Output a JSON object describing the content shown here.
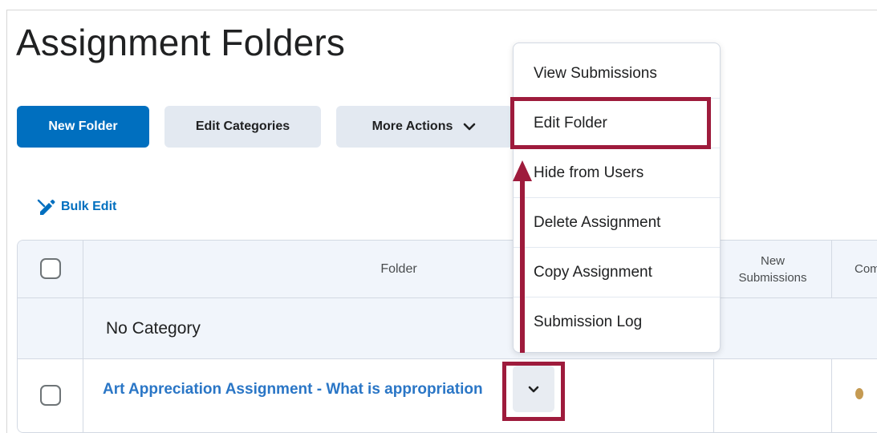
{
  "page": {
    "title": "Assignment Folders"
  },
  "toolbar": {
    "new_folder_label": "New Folder",
    "edit_categories_label": "Edit Categories",
    "more_actions_label": "More Actions",
    "bulk_edit_label": "Bulk Edit"
  },
  "table": {
    "columns": {
      "folder": "Folder",
      "new_submissions_line1": "New",
      "new_submissions_line2": "Submissions",
      "completed_partial": "Com"
    },
    "category": "No Category",
    "rows": [
      {
        "title": "Art Appreciation Assignment - What is appropriation"
      }
    ]
  },
  "context_menu": {
    "items": [
      {
        "label": "View Submissions"
      },
      {
        "label": "Edit Folder"
      },
      {
        "label": "Hide from Users"
      },
      {
        "label": "Delete Assignment"
      },
      {
        "label": "Copy Assignment"
      },
      {
        "label": "Submission Log"
      }
    ]
  },
  "colors": {
    "primary": "#006fbf",
    "link": "#2a76c6",
    "highlight": "#9e1b3c",
    "secondary_button": "#e3e9f1",
    "header_bg": "#f1f5fb"
  },
  "icons": {
    "bulk_edit": "pencil-icon",
    "more_actions": "chevron-down-icon",
    "row_actions": "chevron-down-icon",
    "annotation": "arrow-up-icon"
  }
}
